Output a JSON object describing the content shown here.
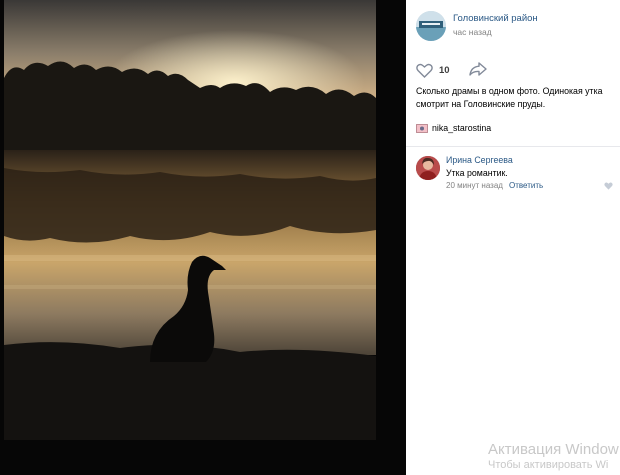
{
  "post": {
    "group_name": "Головинский район",
    "time": "час назад",
    "likes": "10",
    "text_lines": [
      "Сколько драмы в одном фото. Одинокая утка",
      "смотрит на Головинские пруды."
    ],
    "author": "nika_starostina"
  },
  "comment": {
    "name": "Ирина Сергеева",
    "text": "Утка романтик.",
    "time": "20 минут назад",
    "reply_label": "Ответить"
  },
  "watermark": {
    "title": "Активация Window",
    "subtitle": "Чтобы активировать Wi"
  },
  "colors": {
    "link": "#2a5885",
    "meta": "#828282",
    "divider": "#e7e8ec"
  }
}
